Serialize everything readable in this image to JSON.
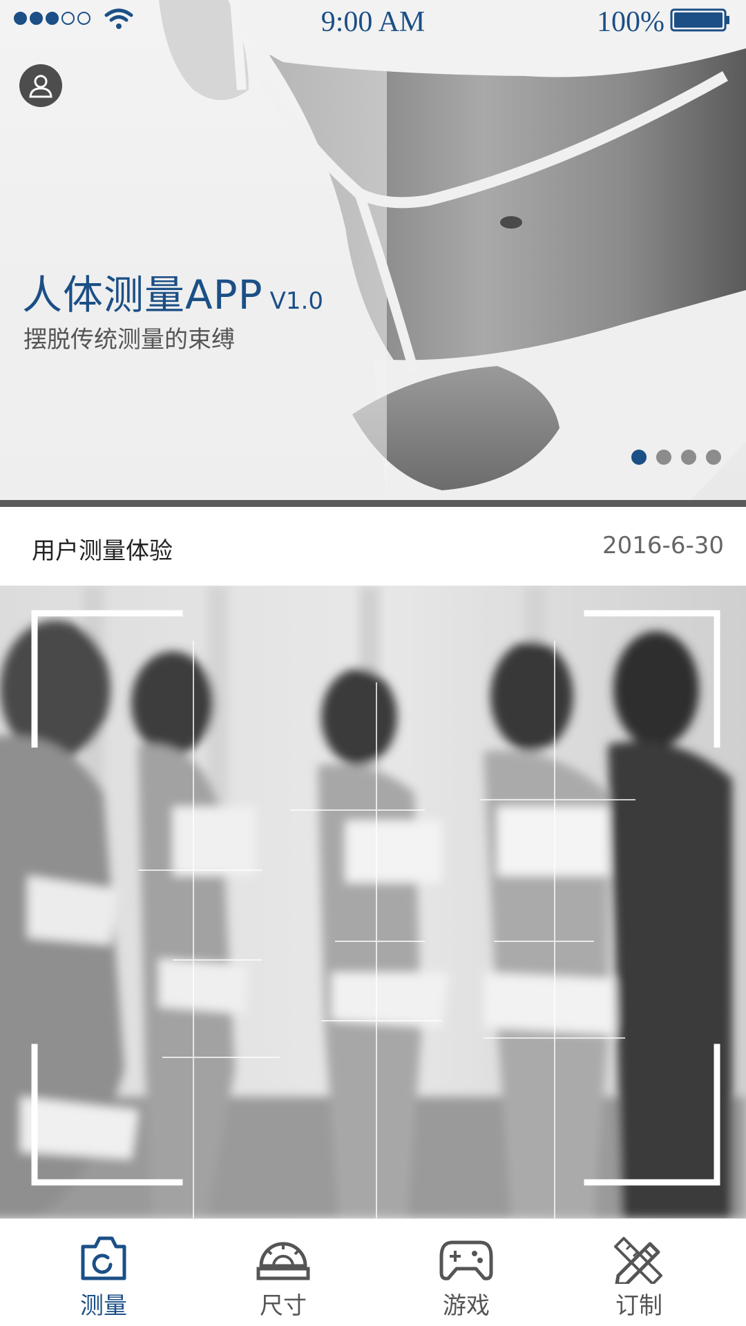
{
  "status_bar": {
    "time": "9:00 AM",
    "battery": "100%",
    "signal_bars_filled": 3,
    "signal_bars_total": 5
  },
  "hero": {
    "title": "人体测量APP",
    "version": "V1.0",
    "subtitle": "摆脱传统测量的束缚",
    "carousel_pages": 4,
    "carousel_active_index": 0
  },
  "card": {
    "title": "用户测量体验",
    "date": "2016-6-30"
  },
  "tabs": [
    {
      "label": "测量",
      "icon": "camera-icon",
      "active": true
    },
    {
      "label": "尺寸",
      "icon": "protractor-ruler-icon",
      "active": false
    },
    {
      "label": "游戏",
      "icon": "gamepad-icon",
      "active": false
    },
    {
      "label": "订制",
      "icon": "pencil-ruler-icon",
      "active": false
    }
  ],
  "colors": {
    "accent": "#1b4f86",
    "inactive": "#555555",
    "pager_inactive": "#8c8c8c",
    "avatar_bg": "#4d4d4d"
  }
}
